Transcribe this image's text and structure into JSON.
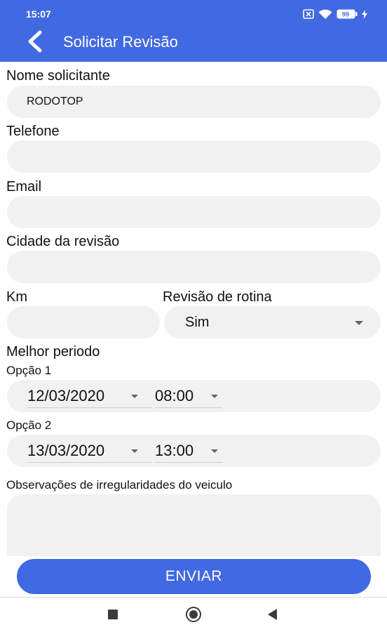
{
  "status_bar": {
    "time": "15:07",
    "battery_level": "99",
    "icons": [
      "notification-x-icon",
      "wifi-icon",
      "battery-icon",
      "charging-icon"
    ]
  },
  "app_bar": {
    "title": "Solicitar Revisão",
    "background": "#4169e1",
    "icon": "back-arrow-icon"
  },
  "form": {
    "requester": {
      "label": "Nome solicitante",
      "value": "RODOTOP"
    },
    "phone": {
      "label": "Telefone",
      "value": ""
    },
    "email": {
      "label": "Email",
      "value": ""
    },
    "city": {
      "label": "Cidade da revisão",
      "value": ""
    },
    "km": {
      "label": "Km",
      "value": ""
    },
    "routine": {
      "label": "Revisão de rotina",
      "value": "Sim"
    },
    "best_period": {
      "label": "Melhor periodo",
      "options": [
        {
          "label": "Opção 1",
          "date": "12/03/2020",
          "time": "08:00"
        },
        {
          "label": "Opção 2",
          "date": "13/03/2020",
          "time": "13:00"
        }
      ]
    },
    "observations": {
      "label": "Observações de irregularidades do veiculo",
      "value": ""
    },
    "submit_label": "ENVIAR"
  },
  "nav_bar": {
    "icons": [
      "recents-square-icon",
      "home-circle-icon",
      "back-triangle-icon"
    ]
  },
  "colors": {
    "accent": "#4169e1",
    "field_background": "#f1f1f1"
  }
}
